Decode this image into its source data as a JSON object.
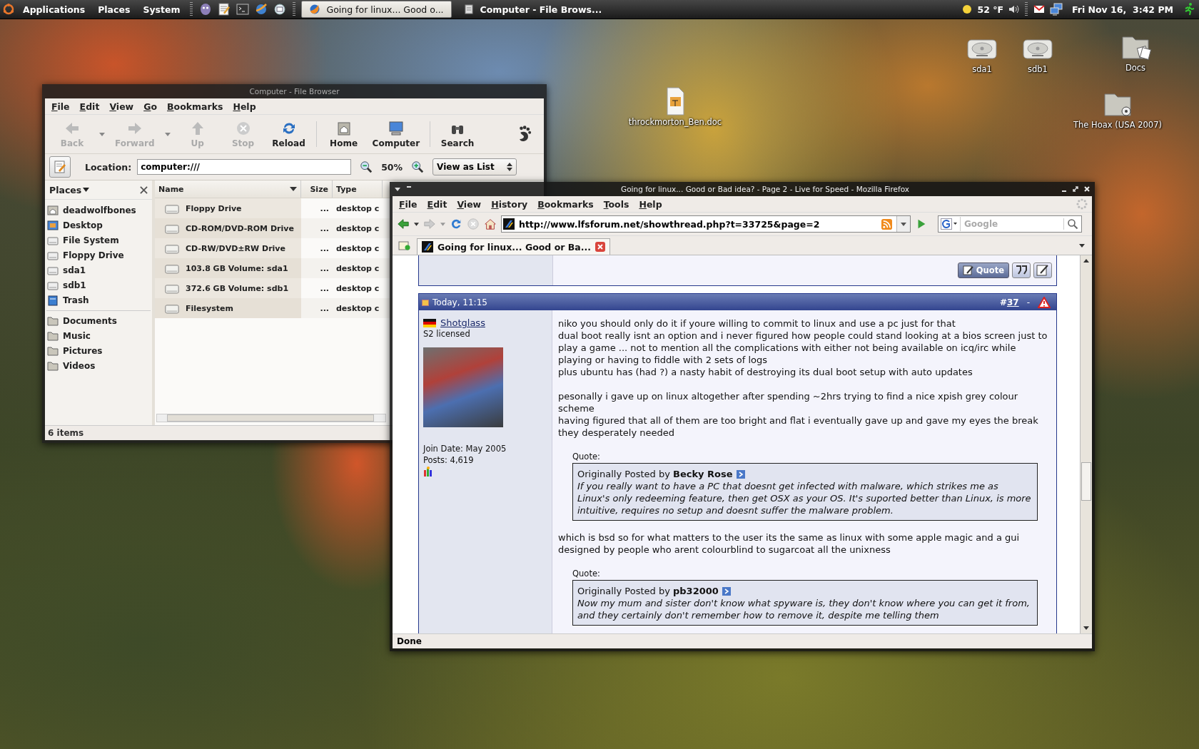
{
  "top_panel": {
    "menus": [
      "Applications",
      "Places",
      "System"
    ],
    "tasks": [
      {
        "label": "Going for linux... Good o...",
        "kind": "browser",
        "selected": true
      },
      {
        "label": "Computer - File Brows...",
        "kind": "files",
        "selected": false
      }
    ],
    "weather": "52 °F",
    "clock": "Fri Nov 16,  3:42 PM"
  },
  "desktop_icons": [
    {
      "label": "sda1",
      "kind": "drive"
    },
    {
      "label": "sdb1",
      "kind": "drive"
    },
    {
      "label": "Docs",
      "kind": "folder-docs"
    },
    {
      "label": "throckmorton_Ben.doc",
      "kind": "document"
    },
    {
      "label": "The Hoax (USA 2007)",
      "kind": "folder-video"
    }
  ],
  "file_browser": {
    "title": "Computer - File Browser",
    "menus": [
      "File",
      "Edit",
      "View",
      "Go",
      "Bookmarks",
      "Help"
    ],
    "toolbar": [
      {
        "label": "Back",
        "kind": "back",
        "disabled": true,
        "menu": true
      },
      {
        "label": "Forward",
        "kind": "forward",
        "disabled": true,
        "menu": true
      },
      {
        "label": "Up",
        "kind": "up",
        "disabled": true,
        "menu": false
      },
      {
        "label": "Stop",
        "kind": "stop",
        "disabled": true,
        "menu": false
      },
      {
        "label": "Reload",
        "kind": "reload",
        "disabled": false,
        "menu": false
      },
      {
        "label": "Home",
        "kind": "home",
        "disabled": false,
        "menu": false
      },
      {
        "label": "Computer",
        "kind": "computer",
        "disabled": false,
        "menu": false
      },
      {
        "label": "Search",
        "kind": "search",
        "disabled": false,
        "menu": false
      }
    ],
    "location_label": "Location:",
    "location": "computer:///",
    "zoom": "50%",
    "view_mode": "View as List",
    "places_title": "Places",
    "places": [
      {
        "label": "deadwolfbones",
        "kind": "home"
      },
      {
        "label": "Desktop",
        "kind": "desktop"
      },
      {
        "label": "File System",
        "kind": "drive"
      },
      {
        "label": "Floppy Drive",
        "kind": "drive"
      },
      {
        "label": "sda1",
        "kind": "drive"
      },
      {
        "label": "sdb1",
        "kind": "drive"
      },
      {
        "label": "Trash",
        "kind": "trash"
      }
    ],
    "bookmarks": [
      {
        "label": "Documents",
        "kind": "folder"
      },
      {
        "label": "Music",
        "kind": "folder"
      },
      {
        "label": "Pictures",
        "kind": "folder"
      },
      {
        "label": "Videos",
        "kind": "folder"
      }
    ],
    "columns": [
      "Name",
      "Size",
      "Type"
    ],
    "rows": [
      {
        "name": "Floppy Drive",
        "size": "...",
        "type": "desktop c"
      },
      {
        "name": "CD-ROM/DVD-ROM Drive",
        "size": "...",
        "type": "desktop c"
      },
      {
        "name": "CD-RW/DVD±RW Drive",
        "size": "...",
        "type": "desktop c"
      },
      {
        "name": "103.8 GB Volume: sda1",
        "size": "...",
        "type": "desktop c"
      },
      {
        "name": "372.6 GB Volume: sdb1",
        "size": "...",
        "type": "desktop c"
      },
      {
        "name": "Filesystem",
        "size": "...",
        "type": "desktop c"
      }
    ],
    "status": "6 items"
  },
  "browser": {
    "title": "Going for linux... Good or Bad idea? - Page 2 - Live for Speed - Mozilla Firefox",
    "menus": [
      "File",
      "Edit",
      "View",
      "History",
      "Bookmarks",
      "Tools",
      "Help"
    ],
    "url": "http://www.lfsforum.net/showthread.php?t=33725&page=2",
    "search_placeholder": "Google",
    "tabs": [
      {
        "label": "Going for linux... Good or Ba...",
        "selected": true
      }
    ],
    "status": "Done",
    "page": {
      "quote_button": "Quote",
      "post": {
        "date": "Today, 11:15",
        "number_prefix": "#",
        "number": "37",
        "separator": "-",
        "user": {
          "name": "Shotglass",
          "title": "S2 licensed",
          "join_date": "Join Date: May 2005",
          "posts": "Posts: 4,619"
        },
        "body": [
          {
            "kind": "text",
            "lines": [
              "niko you should only do it if youre willing to commit to linux and use a pc just for that",
              "dual boot really isnt an option and i never figured how people could stand looking at a bios screen just to play a game ... not to mention all the complications with either not being available on icq/irc while playing or having to fiddle with 2 sets of logs",
              "plus ubuntu has (had ?) a nasty habit of destroying its dual boot setup with auto updates"
            ]
          },
          {
            "kind": "text",
            "lines": [
              "pesonally i gave up on linux altogether after spending ~2hrs trying to find a nice xpish grey colour scheme",
              "having figured that all of them are too bright and flat i eventually gave up and gave my eyes the break they desperately needed"
            ]
          },
          {
            "kind": "quote",
            "label": "Quote:",
            "by": "Originally Posted by **Becky Rose**",
            "text": "If you really want to have a PC that doesnt get infected with malware, which strikes me as Linux's only redeeming feature, then get OSX as your OS. It's suported better than Linux, is more intuitive, requires no setup and doesnt suffer the malware problem."
          },
          {
            "kind": "text",
            "lines": [
              "which is bsd so for what matters to the user its the same as linux with some apple magic and a gui designed by people who arent colourblind to sugarcoat all the unixness"
            ]
          },
          {
            "kind": "quote",
            "label": "Quote:",
            "by": "Originally Posted by **pb32000**",
            "text": "Now my mum and sister don't know what spyware is, they don't know where you can get it from, and they certainly don't remember how to remove it, despite me telling them"
          }
        ]
      }
    }
  }
}
